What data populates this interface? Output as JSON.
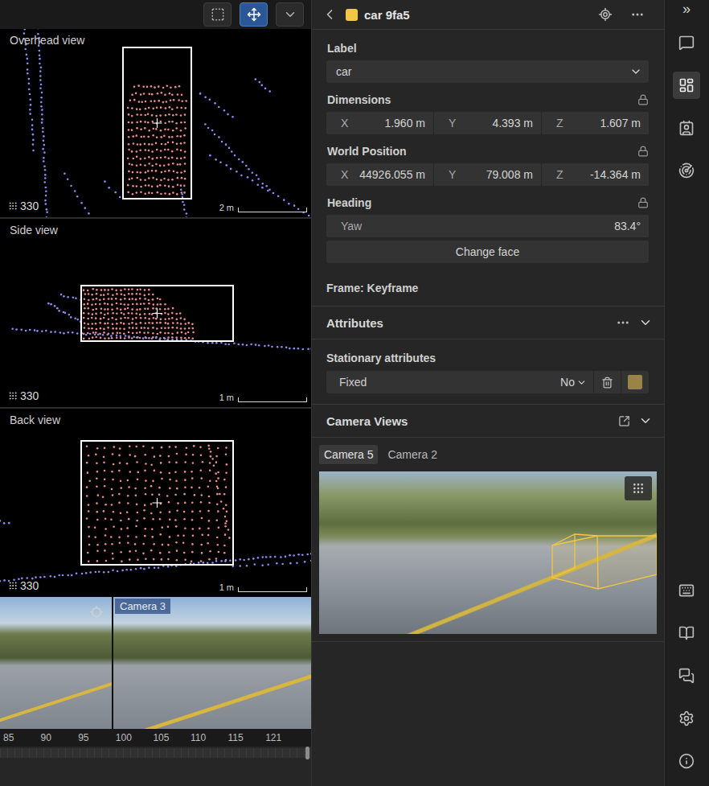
{
  "toolbar": {
    "tools": [
      {
        "kind": "box-select",
        "selected": false
      },
      {
        "kind": "move",
        "selected": true
      },
      {
        "kind": "menu",
        "selected": false
      }
    ]
  },
  "views": [
    {
      "kind": "overhead",
      "title": "Overhead view",
      "points": "330",
      "scale": "2 m"
    },
    {
      "kind": "side",
      "title": "Side view",
      "points": "330",
      "scale": "1 m"
    },
    {
      "kind": "back",
      "title": "Back view",
      "points": "330",
      "scale": "1 m"
    }
  ],
  "camera_strip": {
    "label": "Camera 3"
  },
  "timeline": {
    "ticks": [
      "85",
      "90",
      "95",
      "100",
      "105",
      "110",
      "115",
      "121"
    ]
  },
  "object": {
    "title": "car 9fa5",
    "color": "#f2c744"
  },
  "label_field": {
    "title": "Label",
    "value": "car"
  },
  "dimensions": {
    "title": "Dimensions",
    "fields": [
      {
        "axis": "X",
        "value": "1.960 m"
      },
      {
        "axis": "Y",
        "value": "4.393 m"
      },
      {
        "axis": "Z",
        "value": "1.607 m"
      }
    ]
  },
  "world_position": {
    "title": "World Position",
    "fields": [
      {
        "axis": "X",
        "value": "44926.055 m"
      },
      {
        "axis": "Y",
        "value": "79.008 m"
      },
      {
        "axis": "Z",
        "value": "-14.364 m"
      }
    ]
  },
  "heading": {
    "title": "Heading",
    "fields": [
      {
        "axis": "Yaw",
        "value": "83.4°"
      }
    ]
  },
  "change_face": "Change face",
  "frame": "Frame: Keyframe",
  "attributes": {
    "title": "Attributes",
    "expanded": true,
    "group": "Stationary attributes",
    "rows": [
      {
        "name": "Fixed",
        "value": "No",
        "color": "#9a8445"
      }
    ]
  },
  "camera_views": {
    "title": "Camera Views",
    "expanded": true,
    "tabs": [
      {
        "label": "Camera 5",
        "selected": true
      },
      {
        "label": "Camera 2",
        "selected": false
      }
    ]
  },
  "rail": {
    "collapse": "»",
    "top": [
      {
        "kind": "comments",
        "selected": false
      },
      {
        "kind": "layout",
        "selected": true
      },
      {
        "kind": "details",
        "selected": false
      },
      {
        "kind": "radar",
        "selected": false
      }
    ],
    "bottom": [
      {
        "kind": "keyboard",
        "selected": false
      },
      {
        "kind": "guide",
        "selected": false
      },
      {
        "kind": "chat",
        "selected": false
      },
      {
        "kind": "settings",
        "selected": false
      },
      {
        "kind": "info",
        "selected": false
      }
    ]
  }
}
